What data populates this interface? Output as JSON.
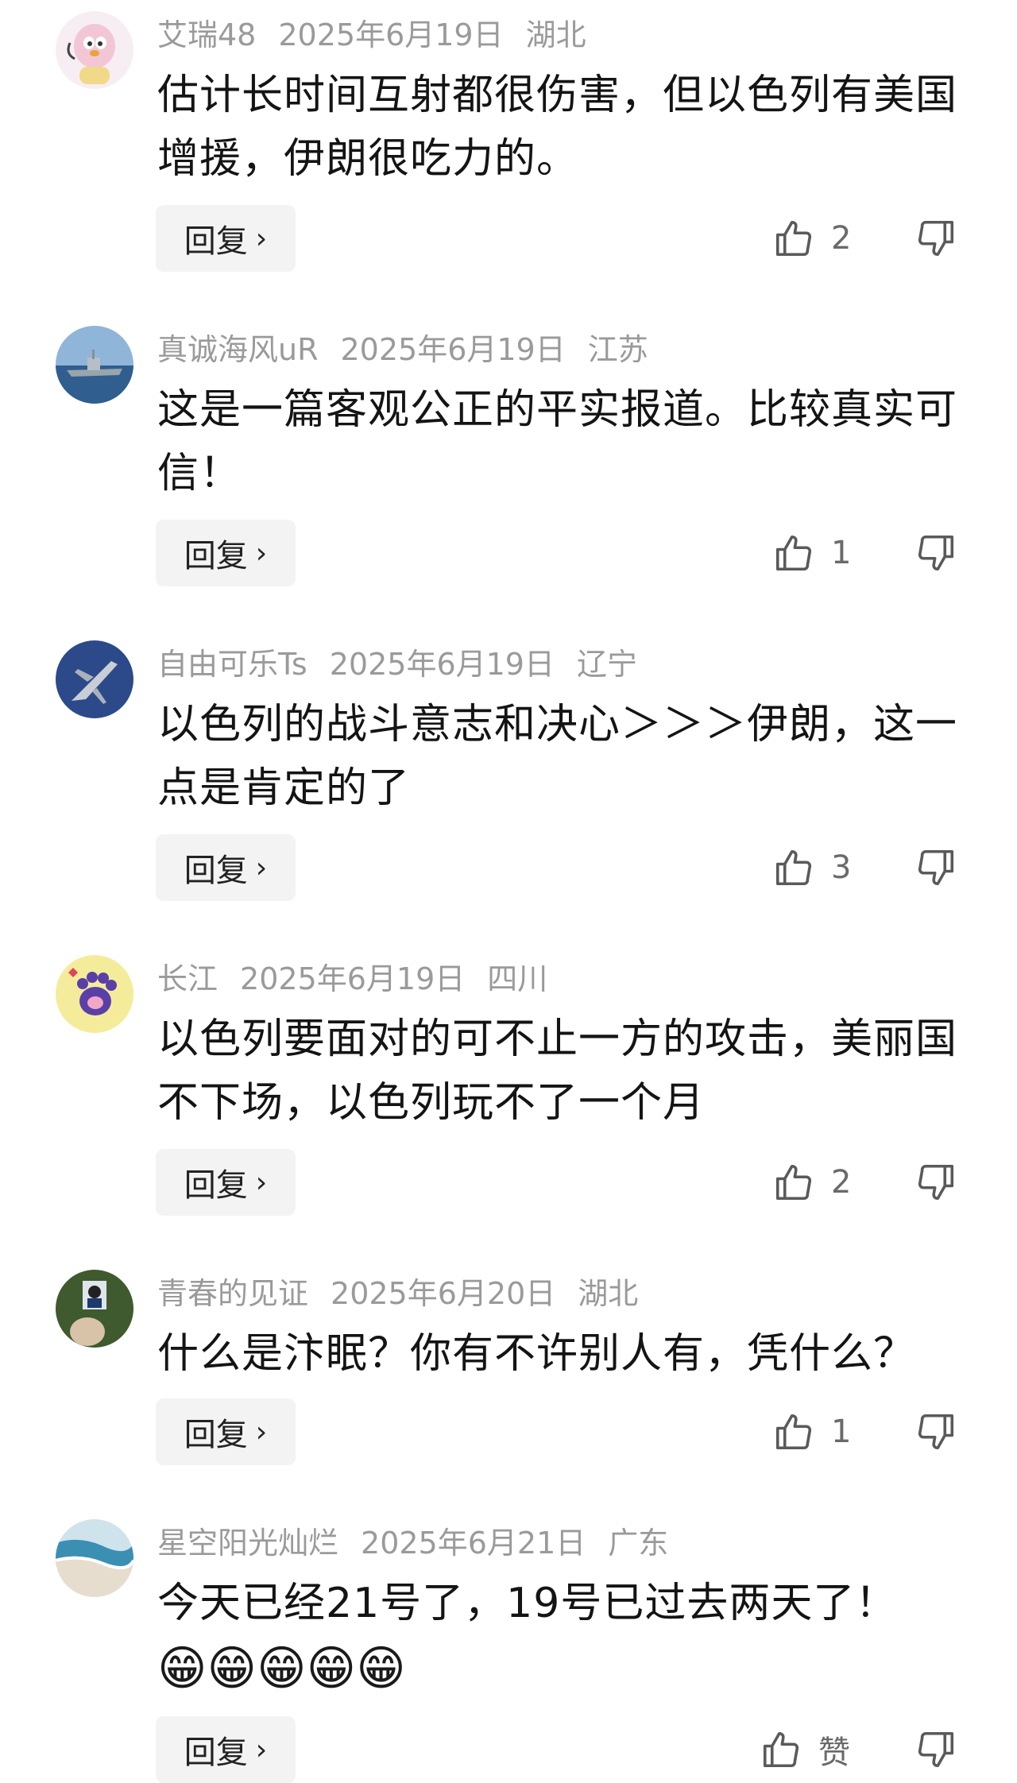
{
  "reply_label": "回复",
  "comments": [
    {
      "username": "艾瑞48",
      "date": "2025年6月19日",
      "location": "湖北",
      "text": "估计长时间互射都很伤害，但以色列有美国增援，伊朗很吃力的。",
      "likes": "2",
      "avatar": "cartoon-bird-avatar"
    },
    {
      "username": "真诚海风uR",
      "date": "2025年6月19日",
      "location": "江苏",
      "text": "这是一篇客观公正的平实报道。比较真实可信！",
      "likes": "1",
      "avatar": "warship-avatar"
    },
    {
      "username": "自由可乐Ts",
      "date": "2025年6月19日",
      "location": "辽宁",
      "text": "以色列的战斗意志和决心＞＞＞伊朗，这一点是肯定的了",
      "likes": "3",
      "avatar": "fighter-jet-avatar"
    },
    {
      "username": "长江",
      "date": "2025年6月19日",
      "location": "四川",
      "text": "以色列要面对的可不止一方的攻击，美丽国不下场，以色列玩不了一个月",
      "likes": "2",
      "avatar": "cat-paw-avatar"
    },
    {
      "username": "青春的见证",
      "date": "2025年6月20日",
      "location": "湖北",
      "text": "什么是汴眠？你有不许别人有，凭什么？",
      "likes": "1",
      "avatar": "portrait-avatar"
    },
    {
      "username": "星空阳光灿烂",
      "date": "2025年6月21日",
      "location": "广东",
      "text": "今天已经21号了，19号已过去两天了！",
      "emoji": "😁😁😁😁😁",
      "likes": "赞",
      "avatar": "ocean-wave-avatar"
    }
  ],
  "icons": {
    "like": "thumbs-up-icon",
    "dislike": "thumbs-down-icon",
    "chevron": "chevron-right-icon"
  },
  "colors": {
    "meta": "#9a9a9a",
    "reply_bg": "#f3f3f3",
    "icon": "#5a5a5a"
  }
}
